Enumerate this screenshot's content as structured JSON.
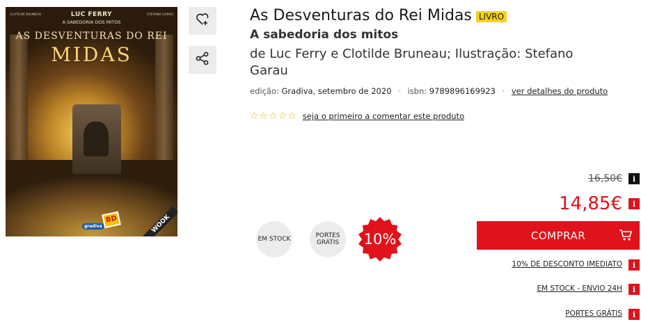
{
  "cover": {
    "author": "LUC FERRY",
    "subtitle": "A SABEDORIA DOS MITOS",
    "small_left": "CLOTILDE BRUNEAU",
    "small_right": "STEFANO GARAU",
    "title_line1": "AS DESVENTURAS DO REI",
    "title_line2": "MIDAS",
    "publisher": "gradiva",
    "bd_logo": "BD",
    "watermark": "WOOK"
  },
  "actions": {
    "favorite_icon": "heart-plus-icon",
    "share_icon": "share-icon"
  },
  "product": {
    "title": "As Desventuras do Rei Midas",
    "type_badge": "LIVRO",
    "subtitle": "A sabedoria dos mitos",
    "authors": "de Luc Ferry e Clotilde Bruneau; Ilustração: Stefano Garau",
    "edition_label": "edição:",
    "edition_value": "Gradiva, setembro de 2020",
    "isbn_label": "isbn:",
    "isbn_value": "9789896169923",
    "details_link": "ver detalhes do produto",
    "rating_stars": "☆☆☆☆☆",
    "rating_link": "seja o primeiro a comentar este produto"
  },
  "badges": {
    "stock": "EM STOCK",
    "portes": "PORTES GRÁTIS",
    "discount": "10%"
  },
  "price": {
    "old": "16,50€",
    "new": "14,85€",
    "info_glyph": "i"
  },
  "buy": {
    "label": "COMPRAR",
    "icon": "cart-icon"
  },
  "perks": [
    "10% DE DESCONTO IMEDIATO",
    "EM STOCK - ENVIO 24H",
    "PORTES GRÁTIS"
  ],
  "colors": {
    "accent": "#e0121b",
    "badge": "#f7d21c",
    "star": "#e8b800"
  }
}
